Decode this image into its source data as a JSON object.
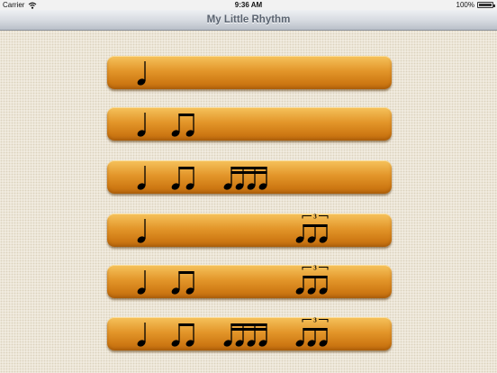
{
  "status_bar": {
    "carrier": "Carrier",
    "time": "9:36 AM",
    "battery": "100%",
    "battery_level": 1.0
  },
  "nav": {
    "title": "My Little Rhythm"
  },
  "rhythm_bars": [
    {
      "id": "rhythm-1",
      "groups": [
        "quarter"
      ]
    },
    {
      "id": "rhythm-2",
      "groups": [
        "quarter",
        "eighth-pair"
      ]
    },
    {
      "id": "rhythm-3",
      "groups": [
        "quarter",
        "eighth-pair",
        "sixteenth-four"
      ]
    },
    {
      "id": "rhythm-4",
      "groups": [
        "quarter",
        "triplet"
      ]
    },
    {
      "id": "rhythm-5",
      "groups": [
        "quarter",
        "eighth-pair",
        "triplet"
      ]
    },
    {
      "id": "rhythm-6",
      "groups": [
        "quarter",
        "eighth-pair",
        "sixteenth-four",
        "triplet"
      ]
    }
  ],
  "triplet_label": "3",
  "colors": {
    "bar_top": "#f6c35c",
    "bar_bottom": "#c06c0e",
    "note": "#000000"
  }
}
